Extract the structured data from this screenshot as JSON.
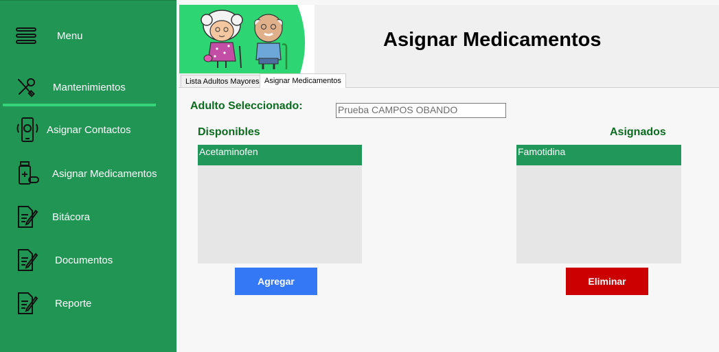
{
  "sidebar": {
    "menu_label": "Menu",
    "items": [
      {
        "label": "Mantenimientos",
        "icon": "tools-icon"
      },
      {
        "label": "Asignar Contactos",
        "icon": "contact-phone-icon"
      },
      {
        "label": "Asignar Medicamentos",
        "icon": "medicine-icon"
      },
      {
        "label": "Bitácora",
        "icon": "document-edit-icon"
      },
      {
        "label": "Documentos",
        "icon": "document-edit-icon"
      },
      {
        "label": "Reporte",
        "icon": "document-edit-icon"
      }
    ]
  },
  "header": {
    "title": "Asignar Medicamentos",
    "logo": "elderly-couple-logo"
  },
  "tabs": [
    {
      "label": "Lista Adultos Mayores",
      "active": false
    },
    {
      "label": "Asignar Medicamentos",
      "active": true
    }
  ],
  "form": {
    "adult_label": "Adulto Seleccionado:",
    "adult_value": "Prueba  CAMPOS OBANDO",
    "available_label": "Disponibles",
    "assigned_label": "Asignados",
    "available_items": [
      "Acetaminofen"
    ],
    "assigned_items": [
      "Famotidina"
    ],
    "add_button": "Agregar",
    "remove_button": "Eliminar"
  },
  "colors": {
    "sidebar": "#219553",
    "accent_green": "#22975a",
    "add_button": "#3478f6",
    "remove_button": "#cc0000",
    "label_green": "#0b6b1f"
  }
}
